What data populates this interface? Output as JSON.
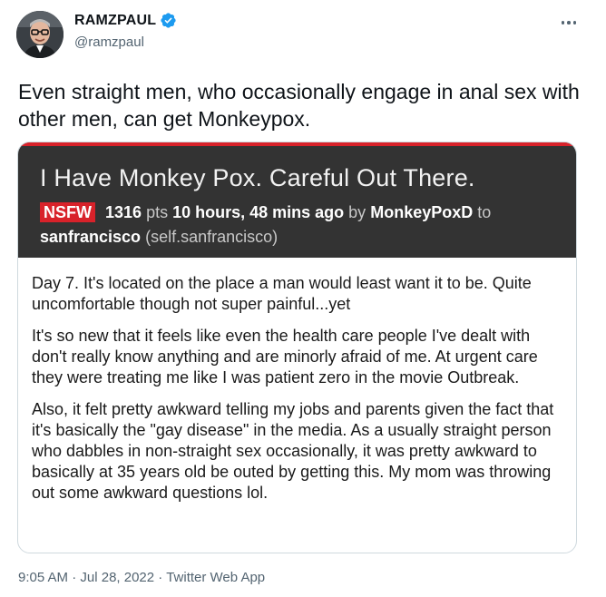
{
  "author": {
    "display_name": "RAMZPAUL",
    "handle": "@ramzpaul",
    "verified_icon": "verified-badge-icon"
  },
  "more_icon": "more-dots-icon",
  "tweet": {
    "text": "Even straight men, who occasionally engage in anal sex with other men, can get Monkeypox."
  },
  "card": {
    "title": "I Have Monkey Pox. Careful Out There.",
    "badge": "NSFW",
    "points": "1316",
    "points_suffix": " pts",
    "age": "10 hours, 48 mins ago",
    "by_word": "by",
    "poster": "MonkeyPoxD",
    "to_word": "to",
    "subreddit": "sanfrancisco",
    "domain": "(self.sanfrancisco)",
    "paragraphs": [
      "Day 7. It's located on the place a man would least want it to be. Quite uncomfortable though not super painful...yet",
      "It's so new that it feels like even the health care people I've dealt with don't really know anything and are minorly afraid of me. At urgent care they were treating me like I was patient zero in the movie Outbreak.",
      "Also, it felt pretty awkward telling my jobs and parents given the fact that it's basically the \"gay disease\" in the media. As a usually straight person who dabbles in non-straight sex occasionally, it was pretty awkward to basically at 35 years old be outed by getting this. My mom was throwing out some awkward questions lol."
    ],
    "colors": {
      "header_bg": "#333333",
      "accent": "#d8222a"
    }
  },
  "footer": {
    "time": "9:05 AM",
    "separator": "·",
    "date": "Jul 28, 2022",
    "source": "Twitter Web App"
  },
  "colors": {
    "verified": "#1d9bf0",
    "secondary_text": "#536471"
  }
}
